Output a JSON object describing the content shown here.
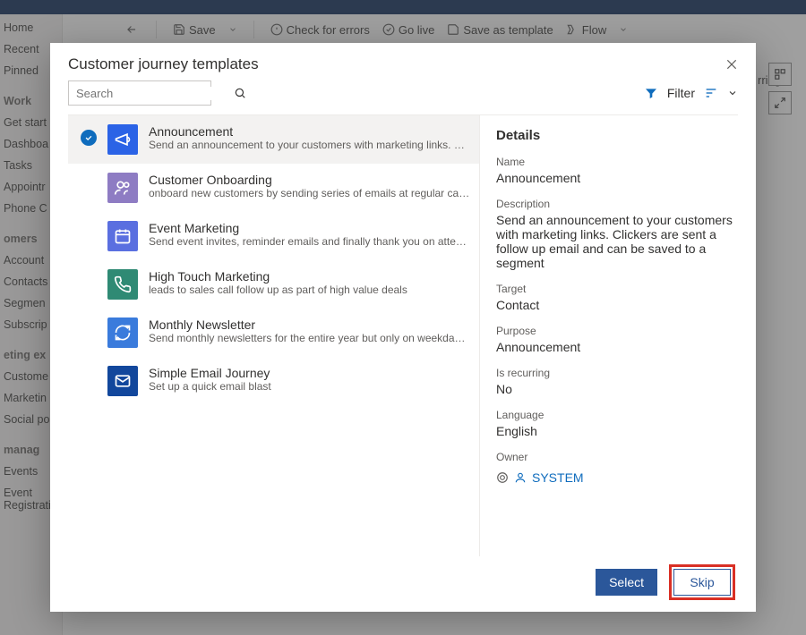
{
  "bg": {
    "cmd": {
      "save": "Save",
      "check": "Check for errors",
      "golive": "Go live",
      "saveas": "Save as template",
      "flow": "Flow"
    },
    "side": {
      "home": "Home",
      "recent": "Recent",
      "pinned": "Pinned",
      "work_hdr": "Work",
      "getstart": "Get start",
      "dashboard": "Dashboa",
      "tasks": "Tasks",
      "appoint": "Appointr",
      "phone": "Phone C",
      "customers_hdr": "omers",
      "account": "Account",
      "contacts": "Contacts",
      "segment": "Segmen",
      "subscrip": "Subscrip",
      "mkt_hdr": "eting ex",
      "custome": "Custome",
      "marketin": "Marketin",
      "social": "Social po",
      "manage_hdr": "manag",
      "events": "Events",
      "evreg": "Event Registrations"
    },
    "right_hint": "rring"
  },
  "modal": {
    "title": "Customer journey templates",
    "search_placeholder": "Search",
    "filter_label": "Filter",
    "templates": [
      {
        "title": "Announcement",
        "desc": "Send an announcement to your customers with marketing links. Clickers are sent a…",
        "color": "#2b63e6",
        "icon": "megaphone"
      },
      {
        "title": "Customer Onboarding",
        "desc": "onboard new customers by sending series of emails at regular cadence",
        "color": "#8e7cc3",
        "icon": "onboard"
      },
      {
        "title": "Event Marketing",
        "desc": "Send event invites, reminder emails and finally thank you on attending",
        "color": "#5a6fe0",
        "icon": "calendar"
      },
      {
        "title": "High Touch Marketing",
        "desc": "leads to sales call follow up as part of high value deals",
        "color": "#2f8a74",
        "icon": "phone"
      },
      {
        "title": "Monthly Newsletter",
        "desc": "Send monthly newsletters for the entire year but only on weekday afternoons",
        "color": "#3a7bdc",
        "icon": "refresh"
      },
      {
        "title": "Simple Email Journey",
        "desc": "Set up a quick email blast",
        "color": "#12479c",
        "icon": "mail"
      }
    ],
    "details": {
      "heading": "Details",
      "name_label": "Name",
      "name": "Announcement",
      "description_label": "Description",
      "description": "Send an announcement to your customers with marketing links. Clickers are sent a follow up email and can be saved to a segment",
      "target_label": "Target",
      "target": "Contact",
      "purpose_label": "Purpose",
      "purpose": "Announcement",
      "recurring_label": "Is recurring",
      "recurring": "No",
      "language_label": "Language",
      "language": "English",
      "owner_label": "Owner",
      "owner": "SYSTEM"
    },
    "buttons": {
      "select": "Select",
      "skip": "Skip"
    }
  }
}
